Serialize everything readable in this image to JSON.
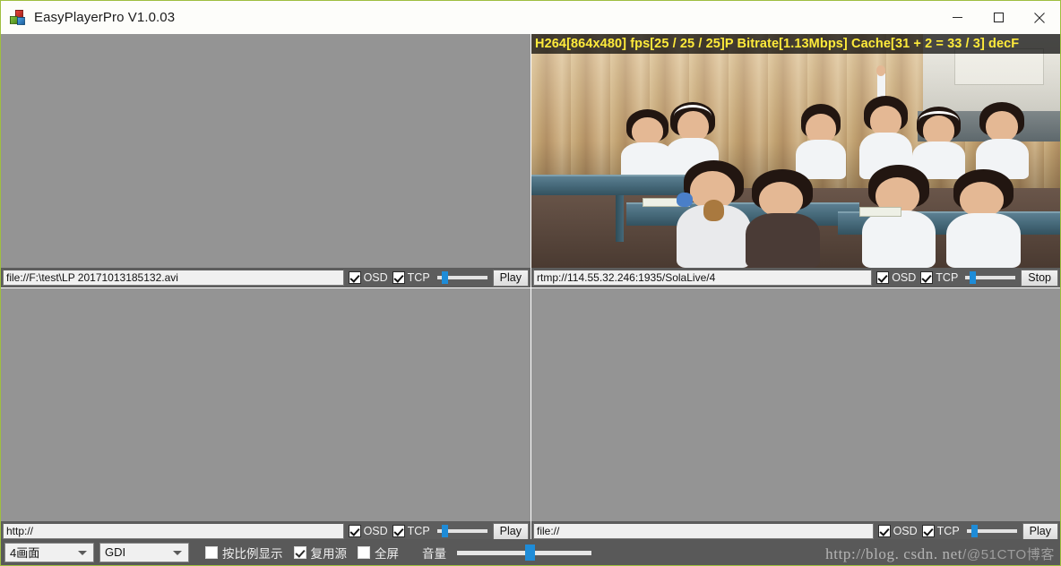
{
  "window": {
    "title": "EasyPlayerPro V1.0.03",
    "icon": "app-blocks-icon",
    "buttons": {
      "minimize": "minimize-icon",
      "maximize": "maximize-icon",
      "close": "close-icon"
    }
  },
  "panes": [
    {
      "id": "top-left",
      "url": "file://F:\\test\\LP 20171013185132.avi",
      "placeholder": "",
      "osd_visible": false,
      "osd_text": "",
      "osd_checked": true,
      "osd_label": "OSD",
      "tcp_checked": true,
      "tcp_label": "TCP",
      "volume": 14,
      "action_label": "Play",
      "playing": false
    },
    {
      "id": "top-right",
      "url": "rtmp://114.55.32.246:1935/SolaLive/4",
      "placeholder": "",
      "osd_visible": true,
      "osd_text": "H264[864x480] fps[25 / 25 / 25]P Bitrate[1.13Mbps] Cache[31 + 2 = 33 / 3] decF",
      "osd_checked": true,
      "osd_label": "OSD",
      "tcp_checked": true,
      "tcp_label": "TCP",
      "volume": 14,
      "action_label": "Stop",
      "playing": true
    },
    {
      "id": "bottom-left",
      "url": "http://",
      "placeholder": "http://",
      "osd_visible": false,
      "osd_text": "",
      "osd_checked": true,
      "osd_label": "OSD",
      "tcp_checked": true,
      "tcp_label": "TCP",
      "volume": 14,
      "action_label": "Play",
      "playing": false
    },
    {
      "id": "bottom-right",
      "url": "file://",
      "placeholder": "file://",
      "osd_visible": false,
      "osd_text": "",
      "osd_checked": true,
      "osd_label": "OSD",
      "tcp_checked": true,
      "tcp_label": "TCP",
      "volume": 14,
      "action_label": "Play",
      "playing": false
    }
  ],
  "toolbar": {
    "layout_select": "4画面",
    "renderer_select": "GDI",
    "aspect_label": "按比例显示",
    "aspect_checked": false,
    "reuse_label": "复用源",
    "reuse_checked": true,
    "fullscreen_label": "全屏",
    "fullscreen_checked": false,
    "volume_label": "音量",
    "volume_value": 55
  },
  "watermark": {
    "text": "http://blog. csdn. net",
    "tail": "/@51CTO博客"
  },
  "colors": {
    "accent_blue": "#1e8cd8",
    "osd_yellow": "#ffeb3b",
    "pane_gray": "#949494",
    "toolbar_gray": "#595959",
    "ctrl_gray": "#5d5d5d",
    "window_border": "#9fbf3f"
  }
}
